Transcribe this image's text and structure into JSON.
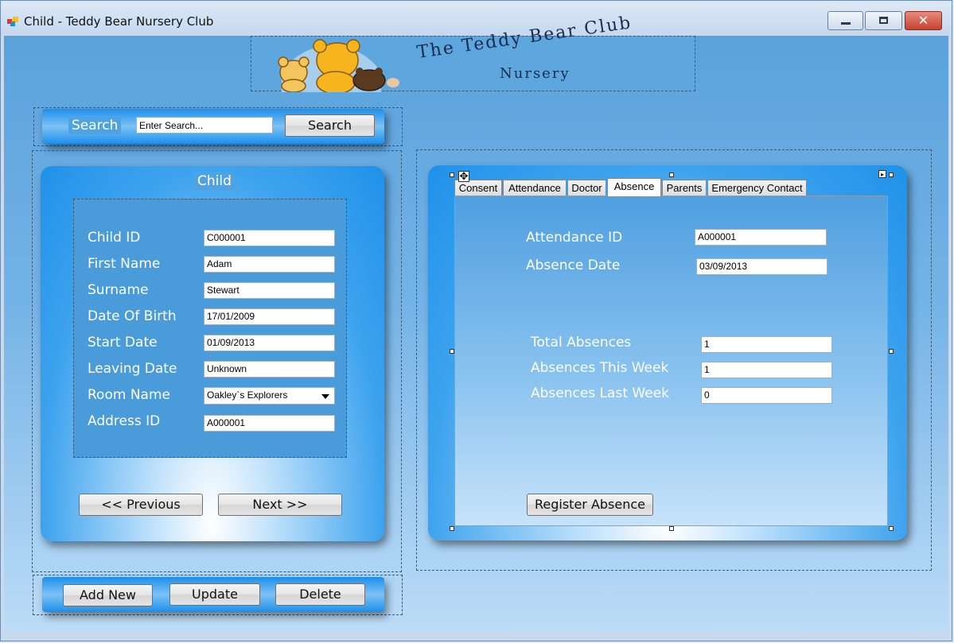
{
  "window": {
    "title": "Child - Teddy Bear Nursery Club"
  },
  "logo": {
    "line1": "The Teddy Bear Club",
    "line2": "Nursery"
  },
  "search": {
    "label": "Search",
    "placeholder": "Enter Search...",
    "button": "Search"
  },
  "child": {
    "heading": "Child",
    "fields": [
      {
        "label": "Child ID",
        "value": "C000001"
      },
      {
        "label": "First Name",
        "value": "Adam"
      },
      {
        "label": "Surname",
        "value": "Stewart"
      },
      {
        "label": "Date Of Birth",
        "value": "17/01/2009"
      },
      {
        "label": "Start Date",
        "value": "01/09/2013"
      },
      {
        "label": "Leaving Date",
        "value": "Unknown"
      },
      {
        "label": "Room Name",
        "value": "Oakley`s Explorers"
      },
      {
        "label": "Address ID",
        "value": "A000001"
      }
    ],
    "previous": "<< Previous",
    "next": "Next >>"
  },
  "tabs": [
    "Consent",
    "Attendance",
    "Doctor",
    "Absence",
    "Parents",
    "Emergency Contact"
  ],
  "absence": {
    "attendance_id_label": "Attendance ID",
    "attendance_id": "A000001",
    "absence_date_label": "Absence Date",
    "absence_date": "03/09/2013",
    "total_label": "Total Absences",
    "total": "1",
    "this_week_label": "Absences This Week",
    "this_week": "1",
    "last_week_label": "Absences Last Week",
    "last_week": "0",
    "register_button": "Register Absence"
  },
  "actions": {
    "add_new": "Add New",
    "update": "Update",
    "delete": "Delete"
  }
}
